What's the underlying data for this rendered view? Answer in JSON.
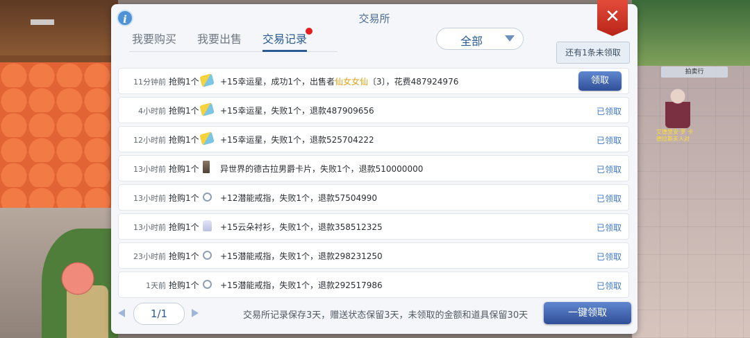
{
  "window": {
    "title": "交易所"
  },
  "tabs": [
    {
      "label": "我要购买",
      "active": false
    },
    {
      "label": "我要出售",
      "active": false
    },
    {
      "label": "交易记录",
      "active": true
    }
  ],
  "filter": {
    "selected": "全部"
  },
  "pending_notice": "还有1条未领取",
  "records": [
    {
      "time": "11分钟前",
      "action": "抢购1个",
      "icon": "ticket-icon",
      "desc_prefix": "+15幸运星，成功1个，出售者",
      "seller": "仙女女仙",
      "desc_suffix": "〔3〕，花费487924976",
      "status": "领取",
      "claimable": true
    },
    {
      "time": "4小时前",
      "action": "抢购1个",
      "icon": "ticket-icon",
      "desc": "+15幸运星，失败1个，退款487909656",
      "status": "已领取",
      "claimable": false
    },
    {
      "time": "12小时前",
      "action": "抢购1个",
      "icon": "ticket-icon",
      "desc": "+15幸运星，失败1个，退款525704222",
      "status": "已领取",
      "claimable": false
    },
    {
      "time": "13小时前",
      "action": "抢购1个",
      "icon": "card-icon",
      "desc": "异世界的德古拉男爵卡片，失败1个，退款510000000",
      "status": "已领取",
      "claimable": false
    },
    {
      "time": "13小时前",
      "action": "抢购1个",
      "icon": "ring-icon",
      "desc": "+12潜能戒指，失败1个，退款57504990",
      "status": "已领取",
      "claimable": false
    },
    {
      "time": "13小时前",
      "action": "抢购1个",
      "icon": "shirt-icon",
      "desc": "+15云朵衬衫，失败1个，退款358512325",
      "status": "已领取",
      "claimable": false
    },
    {
      "time": "23小时前",
      "action": "抢购1个",
      "icon": "ring-icon",
      "desc": "+15潜能戒指，失败1个，退款298231250",
      "status": "已领取",
      "claimable": false
    },
    {
      "time": "1天前",
      "action": "抢购1个",
      "icon": "ring-icon",
      "desc": "+15潜能戒指，失败1个，退款292517986",
      "status": "已领取",
      "claimable": false
    }
  ],
  "footer": {
    "page": "1/1",
    "note": "交易所记录保存3天，赠送状态保留3天，未领取的金额和道具保留30天",
    "claim_all": "一键领取"
  },
  "background": {
    "npc_name": "拍卖行",
    "npc_sub": "艾德里安·罗 卡德拉斯夫人对"
  },
  "colors": {
    "accent": "#2a5a93",
    "close": "#d0352a",
    "highlight": "#e2a013",
    "notify_dot": "#e21e1e"
  }
}
